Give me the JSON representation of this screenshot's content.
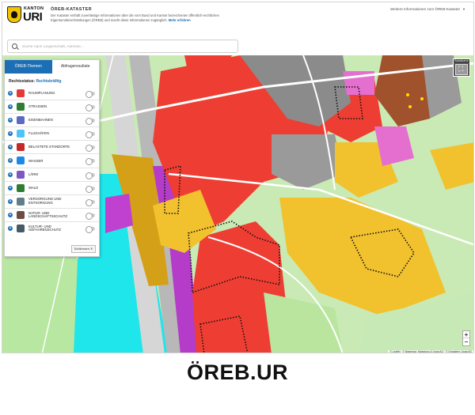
{
  "header": {
    "logo_kanton": "KANTON",
    "logo_uri": "URI",
    "title": "ÖREB-KATASTER",
    "intro": "Der Kataster enthält zuverlässige Informationen über die vom Bund und Kanton bezeichneten öffentlich-rechtlichen Eigentumsbeschränkungen (ÖREB) und macht diese Informationen zugänglich.",
    "intro_more": "Mehr erfahren",
    "external_link": "Weitere Informationen zum ÖREB-Kataster"
  },
  "search": {
    "placeholder": "Suche nach Liegenschaft, Adresse..."
  },
  "panel": {
    "tabs": [
      {
        "label": "ÖREB-Themen",
        "active": true
      },
      {
        "label": "Abfrageresultate",
        "active": false
      }
    ],
    "status_label": "Rechtsstatus:",
    "status_value": "Rechtskräftig",
    "themes": [
      {
        "label": "RAUMPLANUNG",
        "icon": "raumplanung-icon",
        "color": "#e53935",
        "toggle": false
      },
      {
        "label": "STRASSEN",
        "icon": "strassen-icon",
        "color": "#2e7d32",
        "toggle": false
      },
      {
        "label": "EISENBAHNEN",
        "icon": "eisenbahnen-icon",
        "color": "#5c6bc0",
        "toggle": false
      },
      {
        "label": "FLUGHÄFEN",
        "icon": "flughaefen-icon",
        "color": "#4fc3f7",
        "toggle": false
      },
      {
        "label": "BELASTETE STANDORTE",
        "icon": "belastete-standorte-icon",
        "color": "#c62828",
        "toggle": false
      },
      {
        "label": "WASSER",
        "icon": "wasser-icon",
        "color": "#1e88e5",
        "toggle": false
      },
      {
        "label": "LÄRM",
        "icon": "laerm-icon",
        "color": "#7e57c2",
        "toggle": false
      },
      {
        "label": "WALD",
        "icon": "wald-icon",
        "color": "#2e7d32",
        "toggle": false
      },
      {
        "label": "VERSORGUNG UND ENTSORGUNG",
        "icon": "versorgung-icon",
        "color": "#607d8b",
        "toggle": false
      },
      {
        "label": "NATUR- UND LANDSCHAFTSSCHUTZ",
        "icon": "naturschutz-icon",
        "color": "#6d4c41",
        "toggle": false
      },
      {
        "label": "KULTUR- UND GEFAHRENSCHUTZ",
        "icon": "kulturschutz-icon",
        "color": "#455a64",
        "toggle": false
      }
    ],
    "close_label": "Schliessen ✕"
  },
  "map": {
    "basemap_label": "Basiskarte",
    "zoom_in": "+",
    "zoom_out": "−",
    "attribution": "© Leaflet · © Basemap: Swisstopo & Lisag AG · © Geodaten: Lisag AG"
  },
  "caption": "ÖREB.UR"
}
